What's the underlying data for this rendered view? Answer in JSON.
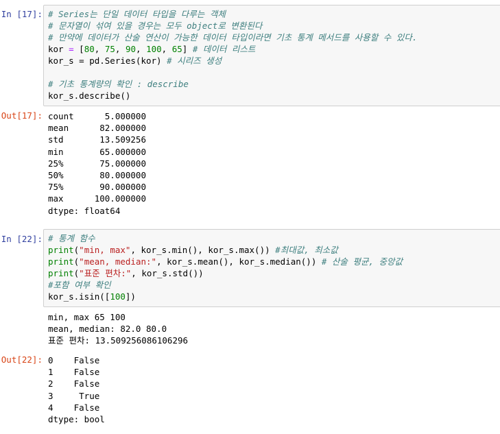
{
  "cells": [
    {
      "in_prompt": "In [17]:",
      "lines": [
        {
          "comment": "# Series는 단일 데이터 타입을 다루는 객체"
        },
        {
          "comment": "# 문자열이 섞여 있을 경우는 모두 object로 변환된다"
        },
        {
          "comment": "# 만약에 데이터가 산술 연산이 가능한 데이터 타입이라면 기초 통계 메서드를 사용할 수 있다."
        },
        {
          "var": "kor",
          "op": " = ",
          "list_open": "[",
          "nums": [
            "80",
            "75",
            "90",
            "100",
            "65"
          ],
          "list_close": "]",
          "comment": " # 데이터 리스트"
        },
        {
          "text": "kor_s = pd.Series(kor)",
          "comment": " # 시리즈 생성"
        },
        {
          "text": ""
        },
        {
          "comment": "# 기초 통계량의 확인 : describe"
        },
        {
          "text": "kor_s.describe()"
        }
      ],
      "out_prompt": "Out[17]:",
      "output": [
        "count      5.000000",
        "mean      82.000000",
        "std       13.509256",
        "min       65.000000",
        "25%       75.000000",
        "50%       80.000000",
        "75%       90.000000",
        "max      100.000000",
        "dtype: float64"
      ]
    },
    {
      "in_prompt": "In [22]:",
      "lines": [
        {
          "comment": "# 통계 함수"
        },
        {
          "fn": "print",
          "str": "\"min, max\"",
          "rest": ", kor_s.min(), kor_s.max())",
          "comment": " #최대값, 최소값"
        },
        {
          "fn": "print",
          "str": "\"mean, median:\"",
          "rest": ", kor_s.mean(), kor_s.median())",
          "comment": " # 산술 평균, 중앙값"
        },
        {
          "fn": "print",
          "str": "\"표준 편차:\"",
          "rest": ", kor_s.std())"
        },
        {
          "comment": "#포함 여부 확인"
        },
        {
          "text_pre": "kor_s.isin([",
          "num": "100",
          "text_post": "])"
        }
      ],
      "stdout": [
        "min, max 65 100",
        "mean, median: 82.0 80.0",
        "표준 편차: 13.509256086106296"
      ],
      "out_prompt": "Out[22]:",
      "output": [
        "0    False",
        "1    False",
        "2    False",
        "3     True",
        "4    False",
        "dtype: bool"
      ]
    }
  ]
}
